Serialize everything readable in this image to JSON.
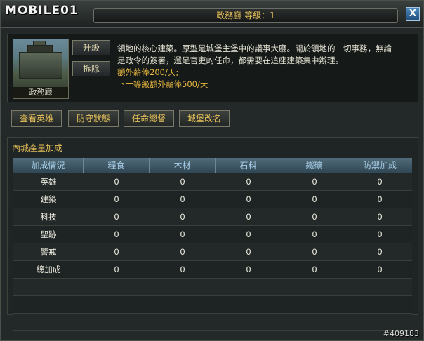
{
  "watermark": "MOBILE01",
  "window": {
    "title": "政務廳 等級：1",
    "close_label": "X"
  },
  "building": {
    "name": "政務廳",
    "upgrade_label": "升級",
    "demolish_label": "拆除",
    "description_line1": "領地的核心建築。原型是城堡主堡中的議事大廳。關於領地的一切事務，無論",
    "description_line2": "是政令的簽署，還是官吏的任命，都需要在這座建築集中辦理。",
    "salary_current": "額外薪俸200/天;",
    "salary_next": "下一等級額外薪俸500/天"
  },
  "actions": [
    "查看英雄",
    "防守狀態",
    "任命總督",
    "城堡改名"
  ],
  "production": {
    "title": "內城產量加成",
    "columns": [
      "加成情況",
      "糧食",
      "木材",
      "石料",
      "鐵礦",
      "防禦加成"
    ],
    "rows": [
      [
        "英雄",
        "0",
        "0",
        "0",
        "0",
        "0"
      ],
      [
        "建築",
        "0",
        "0",
        "0",
        "0",
        "0"
      ],
      [
        "科技",
        "0",
        "0",
        "0",
        "0",
        "0"
      ],
      [
        "聖跡",
        "0",
        "0",
        "0",
        "0",
        "0"
      ],
      [
        "警戒",
        "0",
        "0",
        "0",
        "0",
        "0"
      ],
      [
        "總加成",
        "0",
        "0",
        "0",
        "0",
        "0"
      ]
    ]
  },
  "footer_id": "#409183"
}
